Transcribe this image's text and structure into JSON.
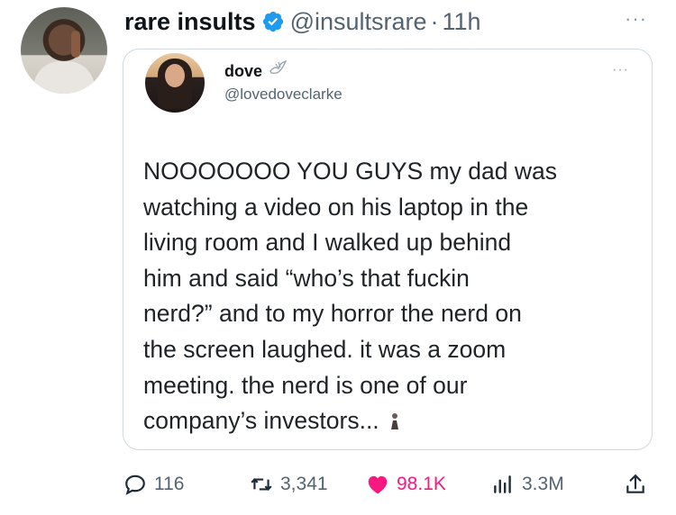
{
  "tweet": {
    "author_name": "rare insults",
    "author_handle": "@insultsrare",
    "separator": "·",
    "time": "11h",
    "more_icon": "more-horizontal-icon",
    "verified_color": "#1d9bf0"
  },
  "quoted": {
    "author_name": "dove",
    "author_handle": "@lovedoveclarke",
    "badge_icon": "dove-icon",
    "text_lines": [
      "NOOOOOOO YOU GUYS my dad was",
      "watching a video on his laptop in the",
      "living room and I walked up behind",
      "him and said “who’s that fuckin",
      "nerd?” and to my horror the nerd on",
      "the screen laughed. it was a zoom",
      "meeting. the nerd is one of our",
      "company’s investors..."
    ],
    "trailing_icon": "person-emoji-icon"
  },
  "actions": {
    "reply_count": "116",
    "retweet_count": "3,341",
    "like_count": "98.1K",
    "views_count": "3.3M",
    "like_color": "#f91880",
    "muted_color": "#536471"
  }
}
